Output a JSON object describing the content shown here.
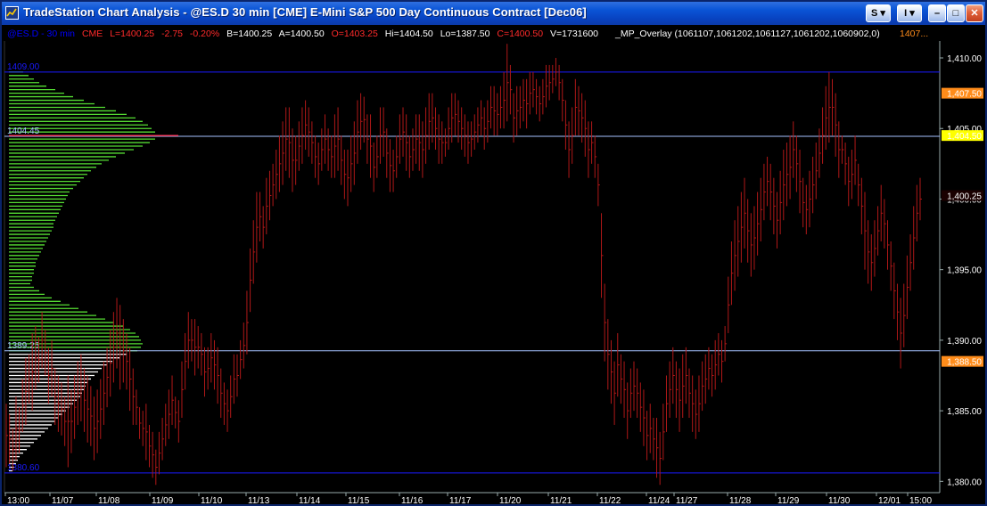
{
  "window": {
    "title": "TradeStation Chart Analysis - @ES.D  30 min  [CME] E-Mini S&P 500 Day Continuous Contract [Dec06]",
    "buttons": {
      "s_label": "S",
      "i_label": "I",
      "min_label": "–",
      "max_label": "□",
      "close_label": "✕"
    }
  },
  "header": {
    "symbol": "@ES.D - 30 min",
    "exchange": "CME",
    "last": "L=1400.25",
    "change": "-2.75",
    "change_pct": "-0.20%",
    "bid": "B=1400.25",
    "ask": "A=1400.50",
    "open": "O=1403.25",
    "high": "Hi=1404.50",
    "low": "Lo=1387.50",
    "close": "C=1400.50",
    "volume": "V=1731600",
    "overlay_label": "_MP_Overlay  (1061107,1061202,1061127,1061202,1060902,0)",
    "overlay_value": "1407..."
  },
  "chart_data": {
    "type": "bar",
    "style": "ohlc-bars-with-market-profile-overlay",
    "x_labels": [
      "13:00",
      "11/07",
      "11/08",
      "11/09",
      "11/10",
      "11/13",
      "11/14",
      "11/15",
      "11/16",
      "11/17",
      "11/20",
      "11/21",
      "11/22",
      "11/24",
      "11/27",
      "11/28",
      "11/29",
      "11/30",
      "12/01",
      "15:00"
    ],
    "y_ticks": [
      "1,410.00",
      "1,405.00",
      "1,400.00",
      "1,395.00",
      "1,390.00",
      "1,385.00",
      "1,380.00"
    ],
    "ylim": [
      1379.2,
      1411.2
    ],
    "grid": false,
    "colors": {
      "bars": "#b01818",
      "profile_upper": "#55dd33",
      "profile_lower": "#ffffff",
      "level_line": "#2a2aff",
      "poc_line": "#ff3355",
      "background": "#000000"
    },
    "levels": [
      {
        "label": "1409.00",
        "value": 1409.0,
        "color": "#1a1aff"
      },
      {
        "label": "1404.45",
        "value": 1404.45,
        "color": "#a6c2ff"
      },
      {
        "label": "1389.25",
        "value": 1389.25,
        "color": "#a6c2ff"
      },
      {
        "label": "1380.60",
        "value": 1380.6,
        "color": "#1a1aff"
      }
    ],
    "price_flags": [
      {
        "label": "1,407.50",
        "value": 1407.5,
        "bg": "#ff8c1a",
        "fg": "#000000"
      },
      {
        "label": "1,404.50",
        "value": 1404.5,
        "bg": "#ffff00",
        "fg": "#000000"
      },
      {
        "label": "1,400.25",
        "value": 1400.25,
        "bg": "#1a0000",
        "fg": "#ff2a2a"
      },
      {
        "label": "1,388.50",
        "value": 1388.5,
        "bg": "#ff8c1a",
        "fg": "#000000"
      }
    ],
    "profile_upper": {
      "prices": [
        1409.0,
        1408.75,
        1408.5,
        1408.25,
        1408.0,
        1407.75,
        1407.5,
        1407.25,
        1407.0,
        1406.75,
        1406.5,
        1406.25,
        1406.0,
        1405.75,
        1405.5,
        1405.25,
        1405.0,
        1404.75,
        1404.5,
        1404.25,
        1404.0,
        1403.75,
        1403.5,
        1403.25,
        1403.0,
        1402.75,
        1402.5,
        1402.25,
        1402.0,
        1401.75,
        1401.5,
        1401.25,
        1401.0,
        1400.75,
        1400.5,
        1400.25,
        1400.0,
        1399.75,
        1399.5,
        1399.25,
        1399.0,
        1398.75,
        1398.5,
        1398.25,
        1398.0,
        1397.75,
        1397.5,
        1397.25,
        1397.0,
        1396.75,
        1396.5,
        1396.25,
        1396.0,
        1395.75,
        1395.5,
        1395.25,
        1395.0,
        1394.75,
        1394.5,
        1394.25,
        1394.0,
        1393.75,
        1393.5,
        1393.25,
        1393.0,
        1392.75,
        1392.5,
        1392.25,
        1392.0,
        1391.75,
        1391.5,
        1391.25,
        1391.0,
        1390.75,
        1390.5,
        1390.25,
        1390.0,
        1389.75,
        1389.5,
        1389.25
      ],
      "tpo": [
        8,
        11,
        14,
        17,
        21,
        26,
        31,
        36,
        42,
        48,
        54,
        60,
        66,
        71,
        75,
        78,
        80,
        82,
        84,
        82,
        79,
        75,
        70,
        65,
        60,
        56,
        52,
        49,
        46,
        44,
        42,
        40,
        38,
        36,
        34,
        33,
        32,
        31,
        30,
        29,
        28,
        27,
        26,
        25,
        25,
        24,
        23,
        22,
        21,
        20,
        19,
        18,
        17,
        16,
        15,
        15,
        14,
        14,
        13,
        13,
        12,
        14,
        17,
        20,
        24,
        29,
        34,
        39,
        44,
        49,
        54,
        59,
        64,
        68,
        71,
        73,
        74,
        75,
        74,
        72
      ]
    },
    "profile_lower": {
      "prices": [
        1389.0,
        1388.75,
        1388.5,
        1388.25,
        1388.0,
        1387.75,
        1387.5,
        1387.25,
        1387.0,
        1386.75,
        1386.5,
        1386.25,
        1386.0,
        1385.75,
        1385.5,
        1385.25,
        1385.0,
        1384.75,
        1384.5,
        1384.25,
        1384.0,
        1383.75,
        1383.5,
        1383.25,
        1383.0,
        1382.75,
        1382.5,
        1382.25,
        1382.0,
        1381.75,
        1381.5,
        1381.25,
        1381.0,
        1380.75
      ],
      "tpo": [
        66,
        62,
        58,
        55,
        52,
        50,
        48,
        46,
        44,
        43,
        42,
        41,
        40,
        38,
        36,
        34,
        32,
        30,
        28,
        26,
        24,
        22,
        20,
        18,
        16,
        14,
        12,
        10,
        8,
        6,
        5,
        4,
        3,
        2
      ]
    },
    "bars": [
      [
        1381.0,
        1385.5
      ],
      [
        1381.25,
        1384.75
      ],
      [
        1380.75,
        1383.75
      ],
      [
        1381.5,
        1386.0
      ],
      [
        1382.0,
        1385.25
      ],
      [
        1383.5,
        1387.25
      ],
      [
        1384.0,
        1388.75
      ],
      [
        1385.5,
        1389.0
      ],
      [
        1385.0,
        1390.5
      ],
      [
        1386.5,
        1391.0
      ],
      [
        1387.0,
        1390.25
      ],
      [
        1388.0,
        1392.0
      ],
      [
        1387.5,
        1390.75
      ],
      [
        1385.5,
        1389.5
      ],
      [
        1386.0,
        1390.0
      ],
      [
        1384.0,
        1388.0
      ],
      [
        1383.5,
        1387.5
      ],
      [
        1383.25,
        1387.0
      ],
      [
        1382.5,
        1386.0
      ],
      [
        1381.0,
        1387.5
      ],
      [
        1382.0,
        1386.5
      ],
      [
        1383.0,
        1387.5
      ],
      [
        1384.0,
        1388.5
      ],
      [
        1384.25,
        1389.0
      ],
      [
        1383.5,
        1388.0
      ],
      [
        1382.75,
        1387.5
      ],
      [
        1382.5,
        1386.75
      ],
      [
        1381.5,
        1386.0
      ],
      [
        1382.0,
        1386.5
      ],
      [
        1383.0,
        1387.25
      ],
      [
        1384.0,
        1388.5
      ],
      [
        1385.25,
        1389.5
      ],
      [
        1386.0,
        1390.75
      ],
      [
        1387.0,
        1392.0
      ],
      [
        1388.0,
        1393.0
      ],
      [
        1386.5,
        1392.5
      ],
      [
        1387.0,
        1391.5
      ],
      [
        1386.5,
        1390.5
      ],
      [
        1385.0,
        1389.5
      ],
      [
        1384.0,
        1388.0
      ],
      [
        1384.0,
        1386.5
      ],
      [
        1383.0,
        1385.25
      ],
      [
        1382.5,
        1385.0
      ],
      [
        1381.5,
        1385.5
      ],
      [
        1381.0,
        1384.0
      ],
      [
        1380.25,
        1383.5
      ],
      [
        1379.75,
        1382.25
      ],
      [
        1380.5,
        1383.5
      ],
      [
        1381.5,
        1384.5
      ],
      [
        1382.5,
        1385.5
      ],
      [
        1383.0,
        1386.5
      ],
      [
        1384.0,
        1387.5
      ],
      [
        1383.75,
        1386.0
      ],
      [
        1382.75,
        1385.75
      ],
      [
        1384.5,
        1388.5
      ],
      [
        1386.5,
        1390.5
      ],
      [
        1388.0,
        1392.0
      ],
      [
        1388.5,
        1391.5
      ],
      [
        1387.5,
        1391.5
      ],
      [
        1388.0,
        1391.0
      ],
      [
        1387.5,
        1390.5
      ],
      [
        1386.0,
        1389.5
      ],
      [
        1386.5,
        1389.5
      ],
      [
        1387.0,
        1390.5
      ],
      [
        1386.5,
        1390.0
      ],
      [
        1385.5,
        1389.5
      ],
      [
        1384.5,
        1388.0
      ],
      [
        1384.0,
        1387.0
      ],
      [
        1383.5,
        1386.5
      ],
      [
        1384.5,
        1387.5
      ],
      [
        1385.5,
        1389.0
      ],
      [
        1386.0,
        1389.0
      ],
      [
        1387.25,
        1390.0
      ],
      [
        1388.0,
        1391.25
      ],
      [
        1389.0,
        1393.5
      ],
      [
        1392.0,
        1396.5
      ],
      [
        1394.0,
        1398.5
      ],
      [
        1395.5,
        1400.5
      ],
      [
        1397.0,
        1400.5
      ],
      [
        1396.5,
        1399.5
      ],
      [
        1397.5,
        1401.5
      ],
      [
        1398.5,
        1402.0
      ],
      [
        1399.5,
        1402.5
      ],
      [
        1400.0,
        1403.5
      ],
      [
        1400.5,
        1404.5
      ],
      [
        1401.0,
        1405.5
      ],
      [
        1402.0,
        1406.5
      ],
      [
        1401.5,
        1406.5
      ],
      [
        1400.5,
        1405.0
      ],
      [
        1401.0,
        1404.5
      ],
      [
        1402.0,
        1405.5
      ],
      [
        1402.5,
        1406.5
      ],
      [
        1403.5,
        1407.0
      ],
      [
        1403.0,
        1406.5
      ],
      [
        1402.5,
        1405.5
      ],
      [
        1401.5,
        1404.5
      ],
      [
        1401.0,
        1404.0
      ],
      [
        1402.0,
        1405.0
      ],
      [
        1402.5,
        1406.0
      ],
      [
        1402.0,
        1405.0
      ],
      [
        1401.5,
        1404.5
      ],
      [
        1401.5,
        1406.0
      ],
      [
        1402.0,
        1406.5
      ],
      [
        1401.0,
        1404.5
      ],
      [
        1400.0,
        1403.5
      ],
      [
        1399.5,
        1403.5
      ],
      [
        1400.5,
        1404.5
      ],
      [
        1401.0,
        1405.5
      ],
      [
        1402.5,
        1407.0
      ],
      [
        1403.5,
        1407.5
      ],
      [
        1404.0,
        1407.25
      ],
      [
        1402.5,
        1406.0
      ],
      [
        1401.5,
        1406.0
      ],
      [
        1400.5,
        1404.0
      ],
      [
        1401.5,
        1404.5
      ],
      [
        1402.5,
        1406.5
      ],
      [
        1403.0,
        1406.5
      ],
      [
        1401.5,
        1405.0
      ],
      [
        1400.5,
        1404.25
      ],
      [
        1400.5,
        1403.5
      ],
      [
        1401.5,
        1404.5
      ],
      [
        1402.5,
        1406.0
      ],
      [
        1403.0,
        1406.5
      ],
      [
        1402.0,
        1406.0
      ],
      [
        1401.5,
        1404.5
      ],
      [
        1402.0,
        1405.0
      ],
      [
        1402.5,
        1406.0
      ],
      [
        1402.0,
        1406.0
      ],
      [
        1401.5,
        1405.5
      ],
      [
        1402.5,
        1406.5
      ],
      [
        1403.5,
        1407.5
      ],
      [
        1404.0,
        1407.5
      ],
      [
        1403.5,
        1406.5
      ],
      [
        1402.5,
        1406.0
      ],
      [
        1402.5,
        1405.5
      ],
      [
        1403.0,
        1405.0
      ],
      [
        1403.5,
        1406.5
      ],
      [
        1404.0,
        1407.5
      ],
      [
        1404.5,
        1407.5
      ],
      [
        1404.0,
        1407.0
      ],
      [
        1403.5,
        1406.5
      ],
      [
        1403.0,
        1406.0
      ],
      [
        1402.5,
        1405.5
      ],
      [
        1403.0,
        1405.5
      ],
      [
        1403.5,
        1406.0
      ],
      [
        1404.0,
        1406.5
      ],
      [
        1404.5,
        1407.0
      ],
      [
        1403.5,
        1406.5
      ],
      [
        1404.0,
        1407.0
      ],
      [
        1405.0,
        1408.0
      ],
      [
        1404.5,
        1408.0
      ],
      [
        1404.5,
        1407.5
      ],
      [
        1405.0,
        1408.0
      ],
      [
        1405.0,
        1409.0
      ],
      [
        1405.5,
        1411.0
      ],
      [
        1406.0,
        1409.5
      ],
      [
        1404.0,
        1407.5
      ],
      [
        1404.5,
        1408.0
      ],
      [
        1405.0,
        1408.0
      ],
      [
        1405.5,
        1408.5
      ],
      [
        1405.0,
        1408.5
      ],
      [
        1406.0,
        1409.0
      ],
      [
        1406.5,
        1409.0
      ],
      [
        1406.0,
        1408.5
      ],
      [
        1405.5,
        1408.0
      ],
      [
        1406.0,
        1408.5
      ],
      [
        1406.5,
        1409.5
      ],
      [
        1407.0,
        1409.5
      ],
      [
        1407.5,
        1409.5
      ],
      [
        1408.0,
        1410.0
      ],
      [
        1407.0,
        1409.5
      ],
      [
        1405.5,
        1408.5
      ],
      [
        1403.5,
        1407.0
      ],
      [
        1401.5,
        1405.5
      ],
      [
        1402.5,
        1406.5
      ],
      [
        1404.5,
        1408.5
      ],
      [
        1404.5,
        1408.0
      ],
      [
        1404.0,
        1407.5
      ],
      [
        1403.0,
        1407.0
      ],
      [
        1401.5,
        1405.5
      ],
      [
        1402.5,
        1405.5
      ],
      [
        1401.5,
        1404.5
      ],
      [
        1399.5,
        1402.5
      ],
      [
        1393.0,
        1399.0
      ],
      [
        1388.5,
        1394.0
      ],
      [
        1386.5,
        1391.5
      ],
      [
        1385.5,
        1390.0
      ],
      [
        1384.0,
        1388.5
      ],
      [
        1386.0,
        1390.5
      ],
      [
        1385.5,
        1389.0
      ],
      [
        1384.5,
        1388.5
      ],
      [
        1383.0,
        1387.0
      ],
      [
        1384.5,
        1388.0
      ],
      [
        1385.0,
        1388.5
      ],
      [
        1384.5,
        1388.0
      ],
      [
        1383.5,
        1387.0
      ],
      [
        1382.5,
        1386.5
      ],
      [
        1381.5,
        1385.0
      ],
      [
        1382.0,
        1385.5
      ],
      [
        1381.5,
        1384.5
      ],
      [
        1380.25,
        1384.5
      ],
      [
        1379.75,
        1383.5
      ],
      [
        1381.5,
        1385.5
      ],
      [
        1383.5,
        1387.5
      ],
      [
        1384.5,
        1388.5
      ],
      [
        1385.5,
        1389.5
      ],
      [
        1384.5,
        1388.5
      ],
      [
        1383.5,
        1388.0
      ],
      [
        1384.5,
        1389.0
      ],
      [
        1385.5,
        1389.5
      ],
      [
        1384.5,
        1388.0
      ],
      [
        1383.5,
        1387.5
      ],
      [
        1383.0,
        1386.5
      ],
      [
        1383.5,
        1387.5
      ],
      [
        1385.0,
        1388.5
      ],
      [
        1385.5,
        1389.0
      ],
      [
        1386.5,
        1389.5
      ],
      [
        1386.0,
        1389.0
      ],
      [
        1386.5,
        1390.0
      ],
      [
        1387.5,
        1390.5
      ],
      [
        1387.0,
        1390.0
      ],
      [
        1388.5,
        1391.0
      ],
      [
        1390.5,
        1394.5
      ],
      [
        1392.5,
        1397.0
      ],
      [
        1393.5,
        1398.5
      ],
      [
        1394.5,
        1399.5
      ],
      [
        1395.5,
        1400.5
      ],
      [
        1396.5,
        1401.5
      ],
      [
        1395.5,
        1400.0
      ],
      [
        1394.5,
        1399.0
      ],
      [
        1395.0,
        1399.5
      ],
      [
        1396.0,
        1400.5
      ],
      [
        1397.0,
        1401.5
      ],
      [
        1398.5,
        1402.5
      ],
      [
        1399.5,
        1403.0
      ],
      [
        1398.5,
        1402.5
      ],
      [
        1397.5,
        1401.5
      ],
      [
        1396.5,
        1400.5
      ],
      [
        1397.5,
        1402.0
      ],
      [
        1398.5,
        1403.5
      ],
      [
        1399.5,
        1404.0
      ],
      [
        1400.0,
        1404.5
      ],
      [
        1401.5,
        1405.5
      ],
      [
        1400.5,
        1404.5
      ],
      [
        1399.0,
        1403.5
      ],
      [
        1398.0,
        1401.5
      ],
      [
        1397.5,
        1401.0
      ],
      [
        1398.0,
        1402.0
      ],
      [
        1399.0,
        1403.0
      ],
      [
        1400.0,
        1404.0
      ],
      [
        1401.5,
        1405.0
      ],
      [
        1402.5,
        1406.5
      ],
      [
        1403.5,
        1408.0
      ],
      [
        1404.0,
        1409.0
      ],
      [
        1404.5,
        1408.5
      ],
      [
        1403.0,
        1407.5
      ],
      [
        1401.5,
        1405.5
      ],
      [
        1402.5,
        1404.5
      ],
      [
        1401.0,
        1404.0
      ],
      [
        1399.5,
        1403.0
      ],
      [
        1400.0,
        1403.5
      ],
      [
        1401.0,
        1404.5
      ],
      [
        1399.5,
        1402.5
      ],
      [
        1397.5,
        1401.5
      ],
      [
        1395.0,
        1400.5
      ],
      [
        1394.0,
        1398.5
      ],
      [
        1393.5,
        1397.5
      ],
      [
        1394.5,
        1398.5
      ],
      [
        1396.0,
        1399.5
      ],
      [
        1397.0,
        1401.0
      ],
      [
        1396.5,
        1400.0
      ],
      [
        1395.0,
        1398.5
      ],
      [
        1393.5,
        1397.0
      ],
      [
        1391.5,
        1395.5
      ],
      [
        1390.0,
        1394.0
      ],
      [
        1388.0,
        1393.0
      ],
      [
        1389.5,
        1394.0
      ],
      [
        1391.5,
        1396.0
      ],
      [
        1393.5,
        1397.5
      ],
      [
        1395.0,
        1399.5
      ],
      [
        1397.0,
        1401.0
      ],
      [
        1398.5,
        1401.5
      ]
    ]
  }
}
